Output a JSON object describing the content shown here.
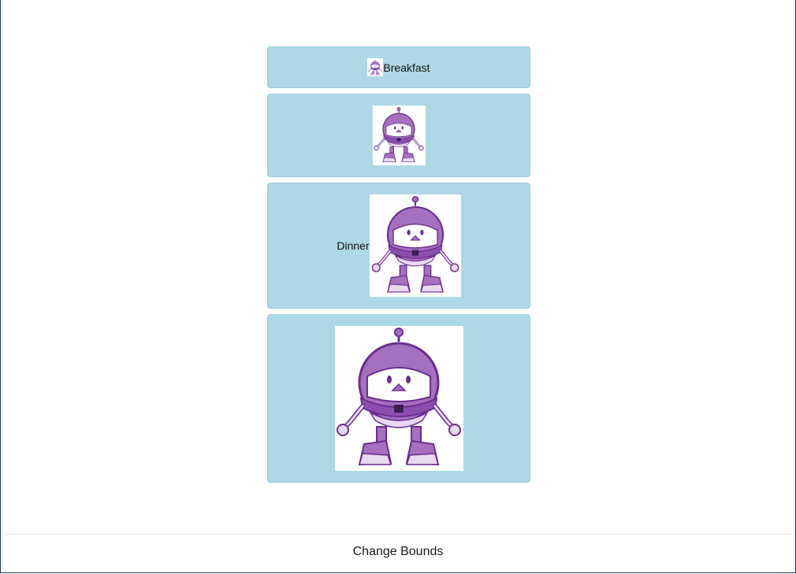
{
  "buttons": [
    {
      "label": "Breakfast",
      "image": "robot-mascot-image"
    },
    {
      "label": "",
      "image": "robot-mascot-image"
    },
    {
      "label": "Dinner",
      "image": "robot-mascot-image"
    },
    {
      "label": "",
      "image": "robot-mascot-image"
    }
  ],
  "footer": {
    "change_bounds_label": "Change Bounds"
  },
  "colors": {
    "button_background": "#add8e6",
    "robot_purple": "#a66fc0",
    "robot_dark": "#6a2d8f",
    "robot_light": "#e8d8f0"
  }
}
